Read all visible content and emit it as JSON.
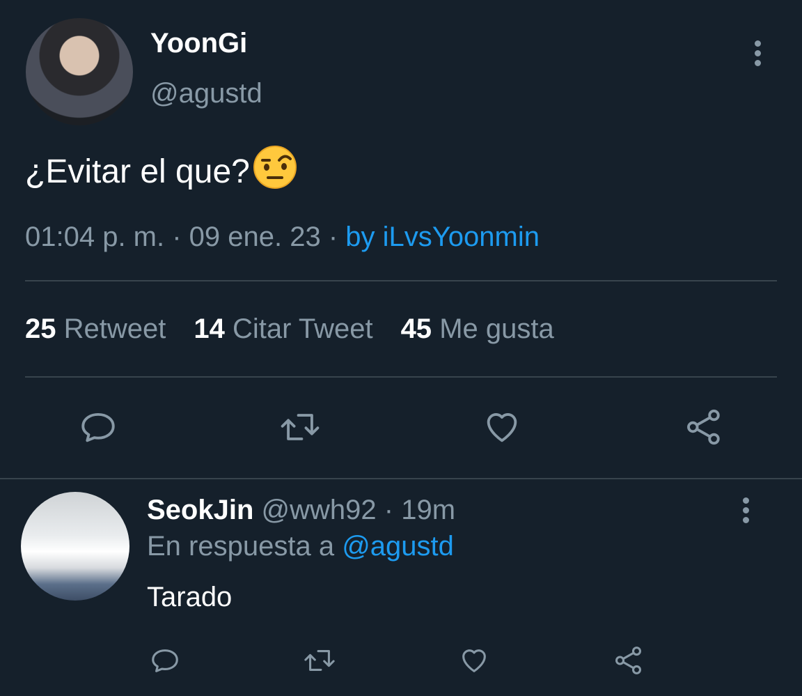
{
  "tweet": {
    "name": "YoonGi",
    "handle": "@agustd",
    "text": "¿Evitar el que?",
    "timestamp": "01:04 p. m. · 09 ene. 23 ·",
    "source": "by iLvsYoonmin",
    "stats": [
      {
        "count": "25",
        "label": "Retweet"
      },
      {
        "count": "14",
        "label": "Citar Tweet"
      },
      {
        "count": "45",
        "label": "Me gusta"
      }
    ]
  },
  "reply": {
    "name": "SeokJin",
    "handle": "@wwh92",
    "time": "· 19m",
    "reply_prefix": "En respuesta a",
    "reply_to": "@agustd",
    "text": "Tarado"
  },
  "icons": {
    "reply": "reply-icon",
    "retweet": "retweet-icon",
    "like": "heart-icon",
    "share": "share-icon",
    "more": "more-vertical-icon"
  },
  "colors": {
    "background": "#15202b",
    "text": "#ffffff",
    "muted": "#8899a6",
    "link": "#1d9bf0",
    "divider": "#38444d"
  }
}
